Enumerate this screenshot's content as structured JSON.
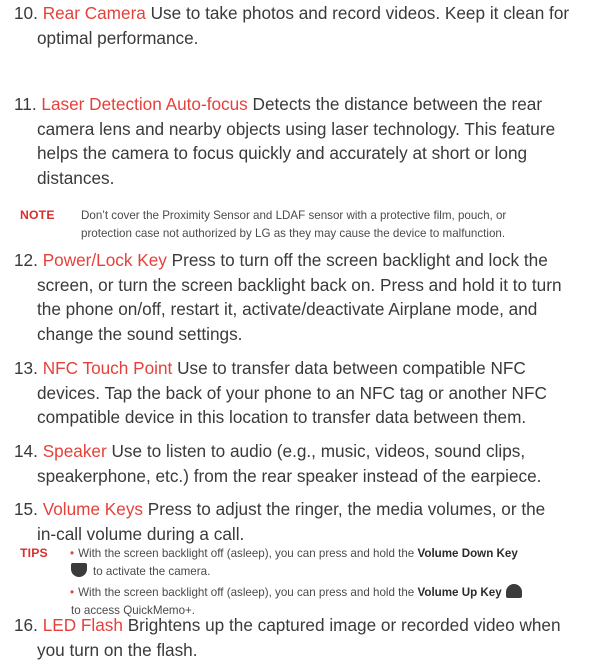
{
  "items": [
    {
      "number": "10.",
      "term": "Rear Camera",
      "lines": [
        " Use to take photos and record videos. Keep it clean for",
        "optimal performance."
      ]
    },
    {
      "number": "11.",
      "term": "Laser Detection Auto-focus",
      "lines": [
        " Detects the distance between the rear",
        "camera lens and nearby objects using laser technology. This feature",
        "helps the camera to focus quickly and accurately at short or long",
        "distances."
      ]
    },
    {
      "number": "12.",
      "term": "Power/Lock Key",
      "lines": [
        " Press to turn off the screen backlight and lock the",
        "screen, or turn the screen backlight back on. Press and hold it to turn",
        "the phone on/off, restart it, activate/deactivate Airplane mode, and",
        "change the sound settings."
      ]
    },
    {
      "number": "13.",
      "term": "NFC Touch Point",
      "lines": [
        " Use to transfer data between compatible NFC",
        "devices. Tap the back of your phone to an NFC tag or another NFC",
        "compatible device in this location to transfer data between them."
      ]
    },
    {
      "number": "14.",
      "term": "Speaker",
      "lines": [
        " Use to listen to audio (e.g., music, videos, sound clips,",
        "speakerphone, etc.) from the rear speaker instead of the earpiece."
      ]
    },
    {
      "number": "15.",
      "term": "Volume Keys",
      "lines": [
        " Press to adjust the ringer, the media volumes, or the",
        "in-call volume during a call."
      ]
    },
    {
      "number": "16.",
      "term": "LED Flash",
      "lines": [
        " Brightens up the captured image or recorded video when",
        "you turn on the flash."
      ]
    }
  ],
  "note": {
    "label": "NOTE",
    "lines": [
      "Don’t cover the Proximity Sensor and LDAF sensor with a protective film, pouch, or",
      "protection case not authorized by LG as they may cause the device to malfunction."
    ]
  },
  "tips": {
    "label": "TIPS",
    "bullet": "•",
    "tip1": {
      "text": "With the screen backlight off (asleep), you can press and hold the ",
      "key": "Volume Down Key",
      "cont": "to activate the camera.",
      "icon": "volume-down-key-icon"
    },
    "tip2": {
      "text": "With the screen backlight off (asleep), you can press and hold the ",
      "key": "Volume Up Key",
      "cont": "to access QuickMemo+.",
      "icon": "volume-up-key-icon"
    }
  },
  "colors": {
    "term": "#e5413a",
    "label": "#d8302c",
    "body": "#3a3a3a"
  }
}
